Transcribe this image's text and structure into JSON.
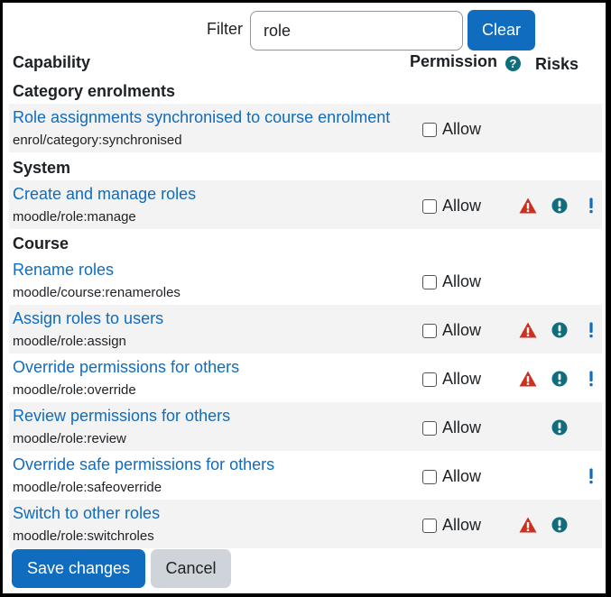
{
  "filter": {
    "label": "Filter",
    "value": "role",
    "clear_label": "Clear"
  },
  "headers": {
    "capability": "Capability",
    "permission": "Permission",
    "help_icon": "question-circle-icon",
    "risks": "Risks"
  },
  "groups": [
    {
      "title": "Category enrolments"
    },
    {
      "title": "System"
    },
    {
      "title": "Course"
    }
  ],
  "capabilities": [
    {
      "name": "Role assignments synchronised to course enrolment",
      "id": "enrol/category:synchronised",
      "allow_label": "Allow",
      "checked": false,
      "risks": []
    },
    {
      "name": "Create and manage roles",
      "id": "moodle/role:manage",
      "allow_label": "Allow",
      "checked": false,
      "risks": [
        "config",
        "xss",
        "spam"
      ]
    },
    {
      "name": "Rename roles",
      "id": "moodle/course:renameroles",
      "allow_label": "Allow",
      "checked": false,
      "risks": []
    },
    {
      "name": "Assign roles to users",
      "id": "moodle/role:assign",
      "allow_label": "Allow",
      "checked": false,
      "risks": [
        "config",
        "xss",
        "spam"
      ]
    },
    {
      "name": "Override permissions for others",
      "id": "moodle/role:override",
      "allow_label": "Allow",
      "checked": false,
      "risks": [
        "config",
        "xss",
        "spam"
      ]
    },
    {
      "name": "Review permissions for others",
      "id": "moodle/role:review",
      "allow_label": "Allow",
      "checked": false,
      "risks": [
        "xss"
      ]
    },
    {
      "name": "Override safe permissions for others",
      "id": "moodle/role:safeoverride",
      "allow_label": "Allow",
      "checked": false,
      "risks": [
        "spam"
      ]
    },
    {
      "name": "Switch to other roles",
      "id": "moodle/role:switchroles",
      "allow_label": "Allow",
      "checked": false,
      "risks": [
        "config",
        "xss"
      ]
    }
  ],
  "risk_icons": {
    "config": {
      "icon": "warning-triangle-icon",
      "color": "#ca3120"
    },
    "xss": {
      "icon": "exclamation-circle-icon",
      "color": "#0f6d7e"
    },
    "spam": {
      "icon": "exclamation-icon",
      "color": "#0f6cbf"
    }
  },
  "actions": {
    "save_label": "Save changes",
    "cancel_label": "Cancel"
  },
  "colors": {
    "primary": "#0f6cbf",
    "secondary": "#ced4da",
    "stripe": "#f3f3f3",
    "link": "#0f6cbf"
  }
}
